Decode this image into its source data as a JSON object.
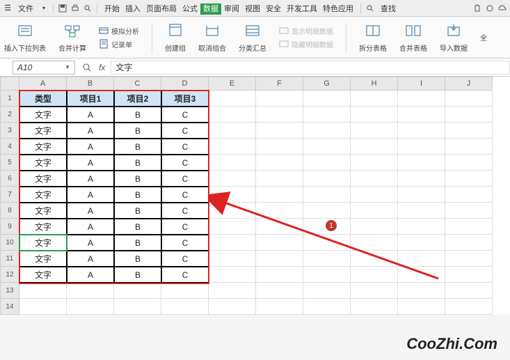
{
  "menubar": {
    "file": "文件",
    "items": [
      "开始",
      "插入",
      "页面布局",
      "公式",
      "数据",
      "审阅",
      "视图",
      "安全",
      "开发工具",
      "特色应用"
    ],
    "active_index": 4,
    "search_label": "查找"
  },
  "ribbon": {
    "groups": [
      {
        "label": "插入下拉列表"
      },
      {
        "label": "合并计算"
      },
      {
        "label": "模拟分析"
      },
      {
        "label": "记录单"
      },
      {
        "label": "创建组"
      },
      {
        "label": "取消组合"
      },
      {
        "label": "分类汇总"
      },
      {
        "label": "显示明细数据"
      },
      {
        "label": "隐藏明细数据"
      },
      {
        "label": "拆分表格"
      },
      {
        "label": "合并表格"
      },
      {
        "label": "导入数据"
      },
      {
        "label": "全"
      }
    ]
  },
  "formula": {
    "name_box": "A10",
    "fx_label": "fx",
    "value": "文字"
  },
  "columns": [
    "A",
    "B",
    "C",
    "D",
    "E",
    "F",
    "G",
    "H",
    "I",
    "J"
  ],
  "row_count": 14,
  "table": {
    "headers": [
      "类型",
      "项目1",
      "项目2",
      "项目3"
    ],
    "rows": [
      [
        "文字",
        "A",
        "B",
        "C"
      ],
      [
        "文字",
        "A",
        "B",
        "C"
      ],
      [
        "文字",
        "A",
        "B",
        "C"
      ],
      [
        "文字",
        "A",
        "B",
        "C"
      ],
      [
        "文字",
        "A",
        "B",
        "C"
      ],
      [
        "文字",
        "A",
        "B",
        "C"
      ],
      [
        "文字",
        "A",
        "B",
        "C"
      ],
      [
        "文字",
        "A",
        "B",
        "C"
      ],
      [
        "文字",
        "A",
        "B",
        "C"
      ],
      [
        "文字",
        "A",
        "B",
        "C"
      ],
      [
        "文字",
        "A",
        "B",
        "C"
      ]
    ]
  },
  "active_cell": {
    "row": 10,
    "col": 1
  },
  "annotation_number": "1",
  "watermark": "CooZhi.Com"
}
